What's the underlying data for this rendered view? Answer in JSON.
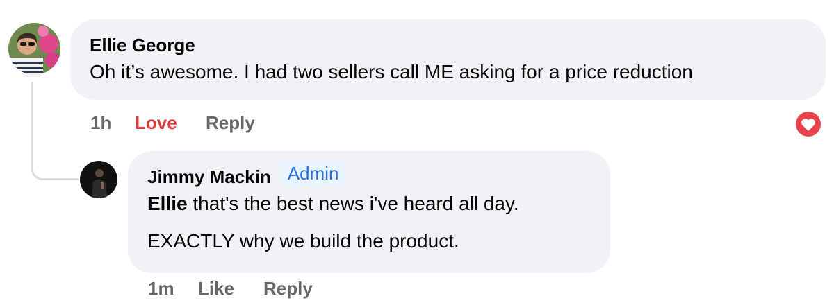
{
  "comments": [
    {
      "author": "Ellie George",
      "text": "Oh it’s awesome. I had two sellers call ME asking for a price reduction",
      "timestamp": "1h",
      "reaction_label": "Love",
      "reply_label": "Reply",
      "reaction_icon": "love-heart-icon",
      "reaction_color": "#e8424c",
      "reaction_label_color": "#d93a3a"
    },
    {
      "author": "Jimmy Mackin",
      "badge": "Admin",
      "mention": "Ellie",
      "text_line1": " that's the best news i've heard all day.",
      "text_line2": "EXACTLY why we build the product.",
      "timestamp": "1m",
      "like_label": "Like",
      "reply_label": "Reply"
    }
  ],
  "colors": {
    "bubble_bg": "#f0f2f5",
    "badge_bg": "#e7f3ff",
    "badge_text": "#2b6fd6",
    "meta_text": "#65676b"
  }
}
